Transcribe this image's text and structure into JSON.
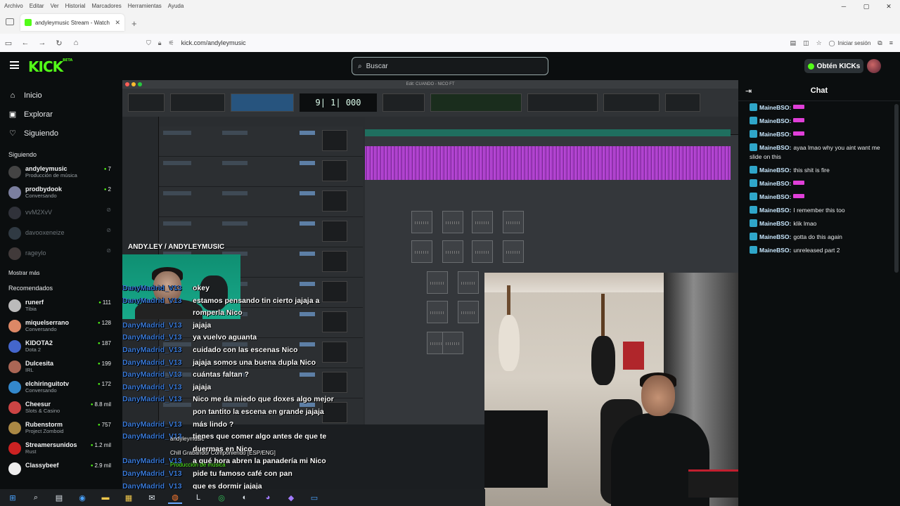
{
  "browser": {
    "menu": [
      "Archivo",
      "Editar",
      "Ver",
      "Historial",
      "Marcadores",
      "Herramientas",
      "Ayuda"
    ],
    "tab_title": "andyleymusic Stream - Watch L",
    "url": "kick.com/andyleymusic",
    "login": "Iniciar sesión"
  },
  "kick": {
    "logo": "KICK",
    "logo_badge": "BETA",
    "search_placeholder": "Buscar",
    "get_kicks": "Obtén KICKs"
  },
  "sidebar": {
    "nav": [
      {
        "label": "Inicio",
        "icon": "home-icon",
        "glyph": "⌂"
      },
      {
        "label": "Explorar",
        "icon": "compass-icon",
        "glyph": "▣"
      },
      {
        "label": "Siguiendo",
        "icon": "heart-icon",
        "glyph": "♡"
      }
    ],
    "following_title": "Siguiendo",
    "following": [
      {
        "name": "andyleymusic",
        "category": "Producción de música",
        "viewers": "7",
        "live": true,
        "color": "#444"
      },
      {
        "name": "prodbydook",
        "category": "Conversando",
        "viewers": "2",
        "live": true,
        "color": "#7b7f9f"
      },
      {
        "name": "vvM2XvV",
        "category": "",
        "viewers": "",
        "live": false,
        "color": "#556"
      },
      {
        "name": "davooxeneize",
        "category": "",
        "viewers": "",
        "live": false,
        "color": "#567"
      },
      {
        "name": "rageylo",
        "category": "",
        "viewers": "",
        "live": false,
        "color": "#766"
      }
    ],
    "show_more": "Mostrar más",
    "recommended_title": "Recomendados",
    "recommended": [
      {
        "name": "runerf",
        "category": "Tibia",
        "viewers": "111",
        "color": "#bbb"
      },
      {
        "name": "miquelserrano",
        "category": "Conversando",
        "viewers": "128",
        "color": "#d86"
      },
      {
        "name": "KIDOTA2",
        "category": "Dota 2",
        "viewers": "187",
        "color": "#46c"
      },
      {
        "name": "Dulcesita",
        "category": "IRL",
        "viewers": "199",
        "color": "#a65"
      },
      {
        "name": "elchiringuitotv",
        "category": "Conversando",
        "viewers": "172",
        "color": "#38c"
      },
      {
        "name": "Cheesur",
        "category": "Slots & Casino",
        "viewers": "8.8 mil",
        "color": "#c44"
      },
      {
        "name": "Rubenstorm",
        "category": "Project Zomboid",
        "viewers": "757",
        "color": "#a84"
      },
      {
        "name": "Streamersunidos",
        "category": "Rust",
        "viewers": "1.2 mil",
        "color": "#c22"
      },
      {
        "name": "Classybeef",
        "category": "",
        "viewers": "2.9 mil",
        "color": "#eee"
      }
    ]
  },
  "stream": {
    "daw_title": "Edit: CUANDO - NICO FT",
    "counter": "9| 1| 000",
    "cam_tag": "ANDY.LEY / ANDYLEYMUSIC",
    "overlay_chat": [
      {
        "user": "DanyMadrid_V13",
        "text": "okey"
      },
      {
        "user": "DanyMadrid_V13",
        "text": "estamos pensando tin cierto jajaja a"
      },
      {
        "user": "",
        "text": "romperla Nico"
      },
      {
        "user": "DanyMadrid_V13",
        "text": "jajaja"
      },
      {
        "user": "DanyMadrid_V13",
        "text": "ya vuelvo aguanta"
      },
      {
        "user": "DanyMadrid_V13",
        "text": "cuidado con las escenas Nico"
      },
      {
        "user": "DanyMadrid_V13",
        "text": "jajaja somos una buena dupla Nico"
      },
      {
        "user": "DanyMadrid_V13",
        "text": "cuántas faltan ?"
      },
      {
        "user": "DanyMadrid_V13",
        "text": "jajaja"
      },
      {
        "user": "DanyMadrid_V13",
        "text": "Nico me da miedo que doxes algo mejor"
      },
      {
        "user": "",
        "text": "pon tantito la escena en grande jajaja"
      },
      {
        "user": "DanyMadrid_V13",
        "text": "más lindo ?"
      },
      {
        "user": "DanyMadrid_V13",
        "text": "tienes que comer algo antes de que te"
      },
      {
        "user": "",
        "text": "duermas en Nico"
      },
      {
        "user": "DanyMadrid_V13",
        "text": "a qué hora abren la panadería mi Nico"
      },
      {
        "user": "DanyMadrid_V13",
        "text": "pide tu famoso café con pan"
      },
      {
        "user": "DanyMadrid_V13",
        "text": "que es dormir jajaja"
      }
    ],
    "now_playing_channel": "andyleymusic",
    "now_playing": "Chill Grabando/ Componiendo [ESP/ENG]",
    "now_playing_category": "Producción de música"
  },
  "chat": {
    "title": "Chat",
    "messages": [
      {
        "user": "MaineBSO:",
        "text": "",
        "emote": true
      },
      {
        "user": "MaineBSO:",
        "text": "",
        "emote": true
      },
      {
        "user": "MaineBSO:",
        "text": "",
        "emote": true
      },
      {
        "user": "MaineBSO:",
        "text": "ayaa lmao why you aint want me slide on this",
        "emote": false
      },
      {
        "user": "MaineBSO:",
        "text": "this shit is fire",
        "emote": false
      },
      {
        "user": "MaineBSO:",
        "text": "",
        "emote": true
      },
      {
        "user": "MaineBSO:",
        "text": "",
        "emote": true
      },
      {
        "user": "MaineBSO:",
        "text": "I remember this too",
        "emote": false
      },
      {
        "user": "MaineBSO:",
        "text": "klik lmao",
        "emote": false
      },
      {
        "user": "MaineBSO:",
        "text": "gotta do this again",
        "emote": false
      },
      {
        "user": "MaineBSO:",
        "text": "unreleased part 2",
        "emote": false
      }
    ]
  },
  "colors": {
    "brand": "#53fc18",
    "page_bg": "#0b0e0f",
    "overlay_user": "#3b7bd9",
    "clip_purple": "#a83bc7"
  },
  "taskbar": [
    {
      "icon": "windows-start-icon",
      "glyph": "⊞",
      "cls": "blue"
    },
    {
      "icon": "search-icon",
      "glyph": "⌕",
      "cls": ""
    },
    {
      "icon": "task-view-icon",
      "glyph": "▤",
      "cls": ""
    },
    {
      "icon": "edge-icon",
      "glyph": "◉",
      "cls": "blue"
    },
    {
      "icon": "folder-icon",
      "glyph": "▬",
      "cls": "yel"
    },
    {
      "icon": "store-icon",
      "glyph": "▦",
      "cls": "yel"
    },
    {
      "icon": "mail-icon",
      "glyph": "✉",
      "cls": ""
    },
    {
      "icon": "firefox-icon",
      "glyph": "◍",
      "cls": "ora act"
    },
    {
      "icon": "live-icon",
      "glyph": "L",
      "cls": ""
    },
    {
      "icon": "chrome-icon",
      "glyph": "◎",
      "cls": "grn"
    },
    {
      "icon": "obs-icon",
      "glyph": "◐",
      "cls": ""
    },
    {
      "icon": "discord-icon",
      "glyph": "◕",
      "cls": "pur"
    },
    {
      "icon": "app-icon",
      "glyph": "◆",
      "cls": "pur"
    },
    {
      "icon": "monitor-icon",
      "glyph": "▭",
      "cls": "blue"
    }
  ]
}
